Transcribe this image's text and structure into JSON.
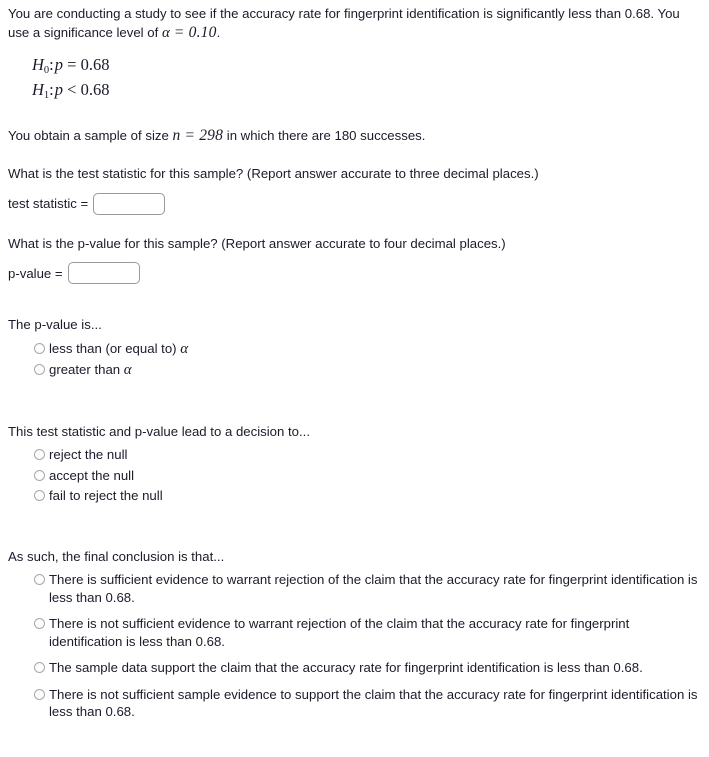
{
  "problem": {
    "intro_part1": "You are conducting a study to see if the accuracy rate for fingerprint identification is significantly less than 0.68. You use a significance level of ",
    "intro_alpha": "α",
    "intro_equals": " = ",
    "intro_alpha_value": "0.10",
    "intro_period": ".",
    "hypotheses": [
      {
        "name": "H",
        "sub": "0",
        "param": "p",
        "relation": "=",
        "value": "0.68"
      },
      {
        "name": "H",
        "sub": "1",
        "param": "p",
        "relation": "<",
        "value": "0.68"
      }
    ],
    "sample_prefix": "You obtain a sample of size ",
    "sample_n_symbol": "n",
    "sample_n_equals": " = ",
    "sample_size": "298",
    "sample_suffix": " in which there are 180 successes."
  },
  "test_statistic_section": {
    "question": "What is the test statistic for this sample? (Report answer accurate to three decimal places.)",
    "label": "test statistic =",
    "value": "",
    "placeholder": ""
  },
  "p_value_section": {
    "question": "What is the p-value for this sample? (Report answer accurate to four decimal places.)",
    "label": "p-value =",
    "value": "",
    "placeholder": ""
  },
  "p_value_comparison": {
    "prompt": "The p-value is...",
    "options": [
      {
        "pre": "less than (or equal to) ",
        "alpha": "α",
        "post": ""
      },
      {
        "pre": "greater than ",
        "alpha": "α",
        "post": ""
      }
    ]
  },
  "decision": {
    "prompt": "This test statistic and p-value lead to a decision to...",
    "options": [
      "reject the null",
      "accept the null",
      "fail to reject the null"
    ]
  },
  "conclusion": {
    "prompt": "As such, the final conclusion is that...",
    "options": [
      "There is sufficient evidence to warrant rejection of the claim that the accuracy rate for fingerprint identification is less than 0.68.",
      "There is not sufficient evidence to warrant rejection of the claim that the accuracy rate for fingerprint identification is less than 0.68.",
      "The sample data support the claim that the accuracy rate for fingerprint identification is less than 0.68.",
      "There is not sufficient sample evidence to support the claim that the accuracy rate for fingerprint identification is less than 0.68."
    ]
  },
  "colors": {
    "text": "#1b1b2a",
    "border": "#9a9a9a",
    "radio_border": "#a8a8a8",
    "background": "#ffffff"
  }
}
